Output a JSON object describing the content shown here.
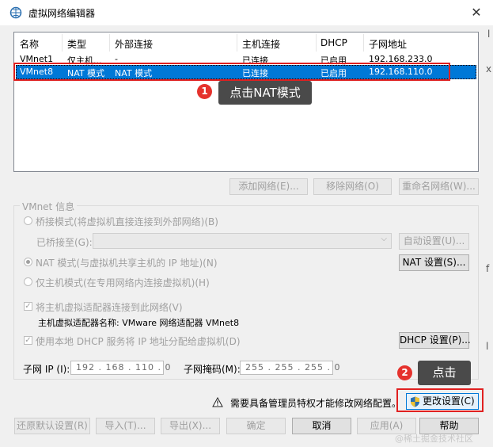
{
  "window": {
    "title": "虚拟网络编辑器",
    "close": "✕"
  },
  "table": {
    "headers": [
      "名称",
      "类型",
      "外部连接",
      "主机连接",
      "DHCP",
      "子网地址"
    ],
    "rows": [
      [
        "VMnet1",
        "仅主机...",
        "-",
        "已连接",
        "已启用",
        "192.168.233.0"
      ],
      [
        "VMnet8",
        "NAT 模式",
        "NAT 模式",
        "已连接",
        "已启用",
        "192.168.110.0"
      ]
    ]
  },
  "list_buttons": {
    "add": "添加网络(E)...",
    "remove": "移除网络(O)",
    "rename": "重命名网络(W)..."
  },
  "vmnet_info": {
    "title": "VMnet 信息",
    "bridge": "桥接模式(将虚拟机直接连接到外部网络)(B)",
    "bridged_to": "已桥接至(G):",
    "auto_settings": "自动设置(U)...",
    "nat": "NAT 模式(与虚拟机共享主机的 IP 地址)(N)",
    "nat_settings": "NAT 设置(S)...",
    "host_only": "仅主机模式(在专用网络内连接虚拟机)(H)",
    "connect_adapter": "将主机虚拟适配器连接到此网络(V)",
    "adapter_name": "主机虚拟适配器名称: VMware 网络适配器 VMnet8",
    "dhcp": "使用本地 DHCP 服务将 IP 地址分配给虚拟机(D)",
    "dhcp_settings": "DHCP 设置(P)...",
    "subnet_ip_label": "子网 IP (I):",
    "subnet_ip": "192 . 168 . 110 .  0",
    "mask_label": "子网掩码(M):",
    "mask": "255 . 255 . 255 .  0"
  },
  "admin": {
    "notice": "需要具备管理员特权才能修改网络配置。",
    "change_settings": "更改设置(C)"
  },
  "footer": {
    "restore": "还原默认设置(R)",
    "import": "导入(T)...",
    "export": "导出(X)...",
    "ok": "确定",
    "cancel": "取消",
    "apply": "应用(A)",
    "help": "帮助"
  },
  "annotations": {
    "badge1": "1",
    "tip1": "点击NAT模式",
    "badge2": "2",
    "tip2": "点击"
  },
  "watermark": "@稀土掘金技术社区",
  "colors": {
    "selection": "#0078d7",
    "highlight_red": "#e02020",
    "badge_red": "#e5322d",
    "tooltip_bg": "#4a4a4a"
  }
}
